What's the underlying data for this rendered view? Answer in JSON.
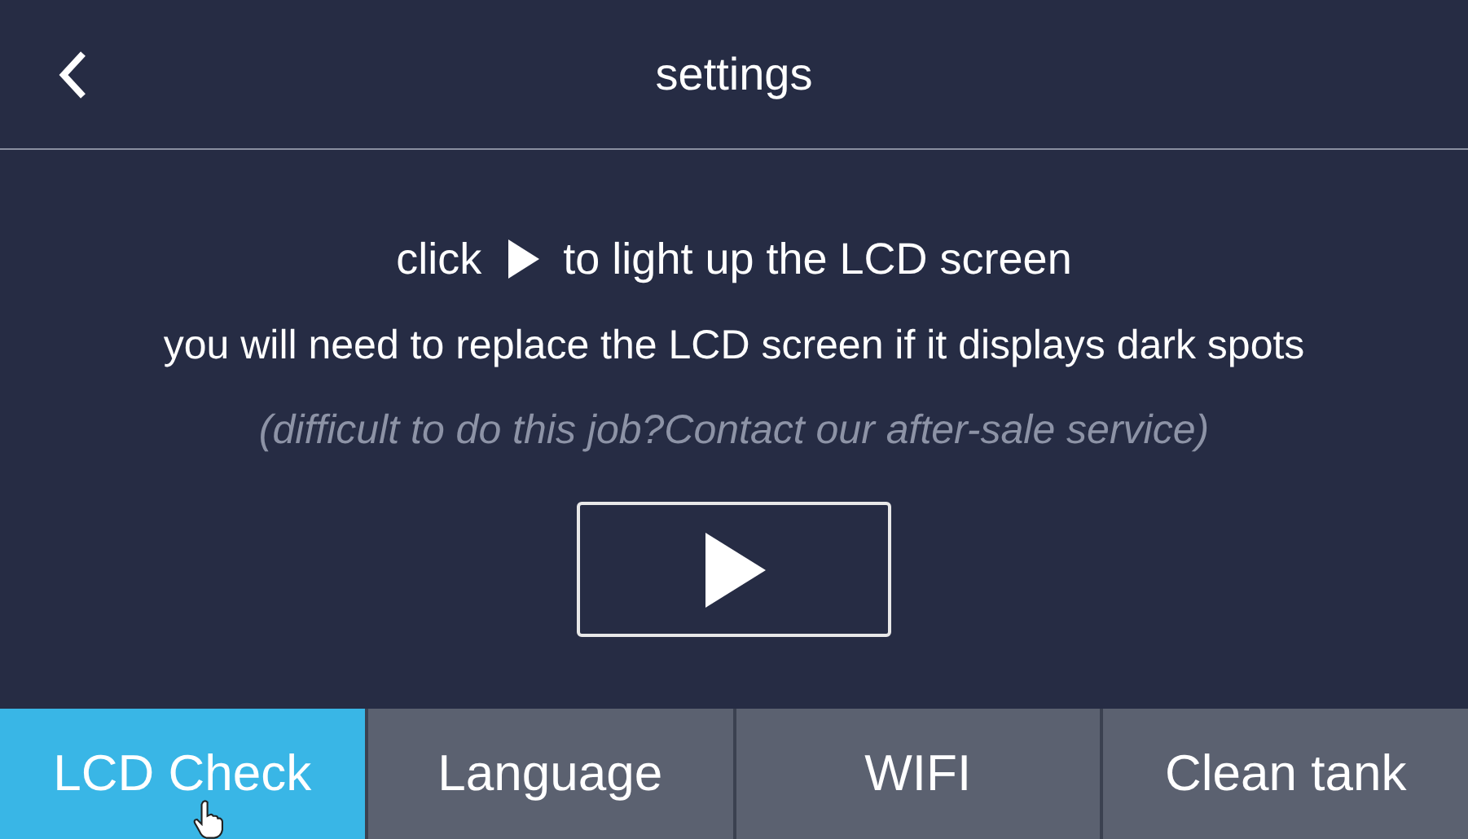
{
  "header": {
    "title": "settings"
  },
  "instruction": {
    "before": "click",
    "after": "to light up the LCD screen"
  },
  "warning": "you will need to replace the LCD screen if it displays dark spots",
  "hint": "(difficult to do this job?Contact our after-sale service)",
  "tabs": [
    {
      "label": "LCD Check",
      "selected": true
    },
    {
      "label": "Language",
      "selected": false
    },
    {
      "label": "WIFI",
      "selected": false
    },
    {
      "label": "Clean tank",
      "selected": false
    }
  ]
}
